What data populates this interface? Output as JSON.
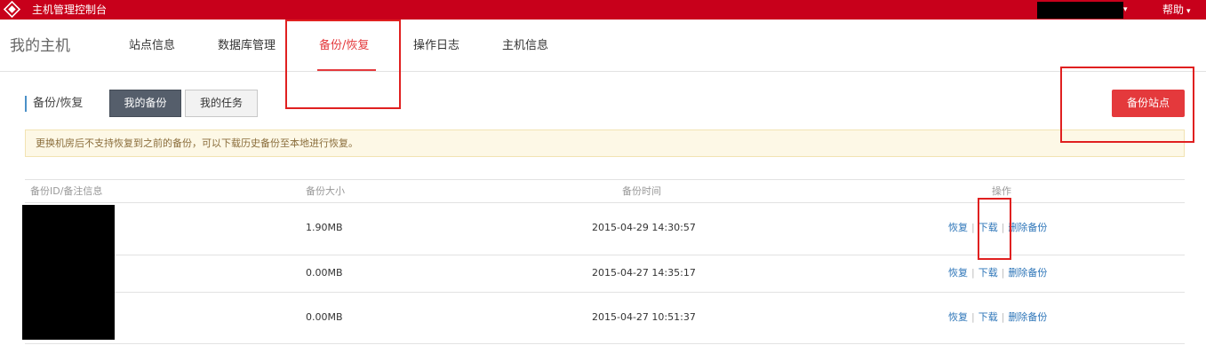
{
  "topbar": {
    "title": "主机管理控制台",
    "help_label": "帮助",
    "caret": "▾"
  },
  "nav": {
    "page_title": "我的主机",
    "tabs": [
      {
        "label": "站点信息",
        "active": false
      },
      {
        "label": "数据库管理",
        "active": false
      },
      {
        "label": "备份/恢复",
        "active": true
      },
      {
        "label": "操作日志",
        "active": false
      },
      {
        "label": "主机信息",
        "active": false
      }
    ]
  },
  "subheader": {
    "section_label": "备份/恢复",
    "my_backups": "我的备份",
    "my_tasks": "我的任务",
    "backup_site": "备份站点"
  },
  "notice": "更换机房后不支持恢复到之前的备份，可以下载历史备份至本地进行恢复。",
  "table": {
    "headers": [
      "备份ID/备注信息",
      "备份大小",
      "备份时间",
      "操作"
    ],
    "rows": [
      {
        "size": "1.90MB",
        "time": "2015-04-29 14:30:57"
      },
      {
        "size": "0.00MB",
        "time": "2015-04-27 14:35:17"
      },
      {
        "size": "0.00MB",
        "time": "2015-04-27 10:51:37"
      }
    ],
    "actions": {
      "restore": "恢复",
      "download": "下载",
      "delete": "删除备份",
      "sep": "|"
    }
  },
  "colors": {
    "brand_red": "#c8001b",
    "accent_red": "#e4393c",
    "link_blue": "#2d75b8",
    "highlight_red": "#e02020"
  }
}
